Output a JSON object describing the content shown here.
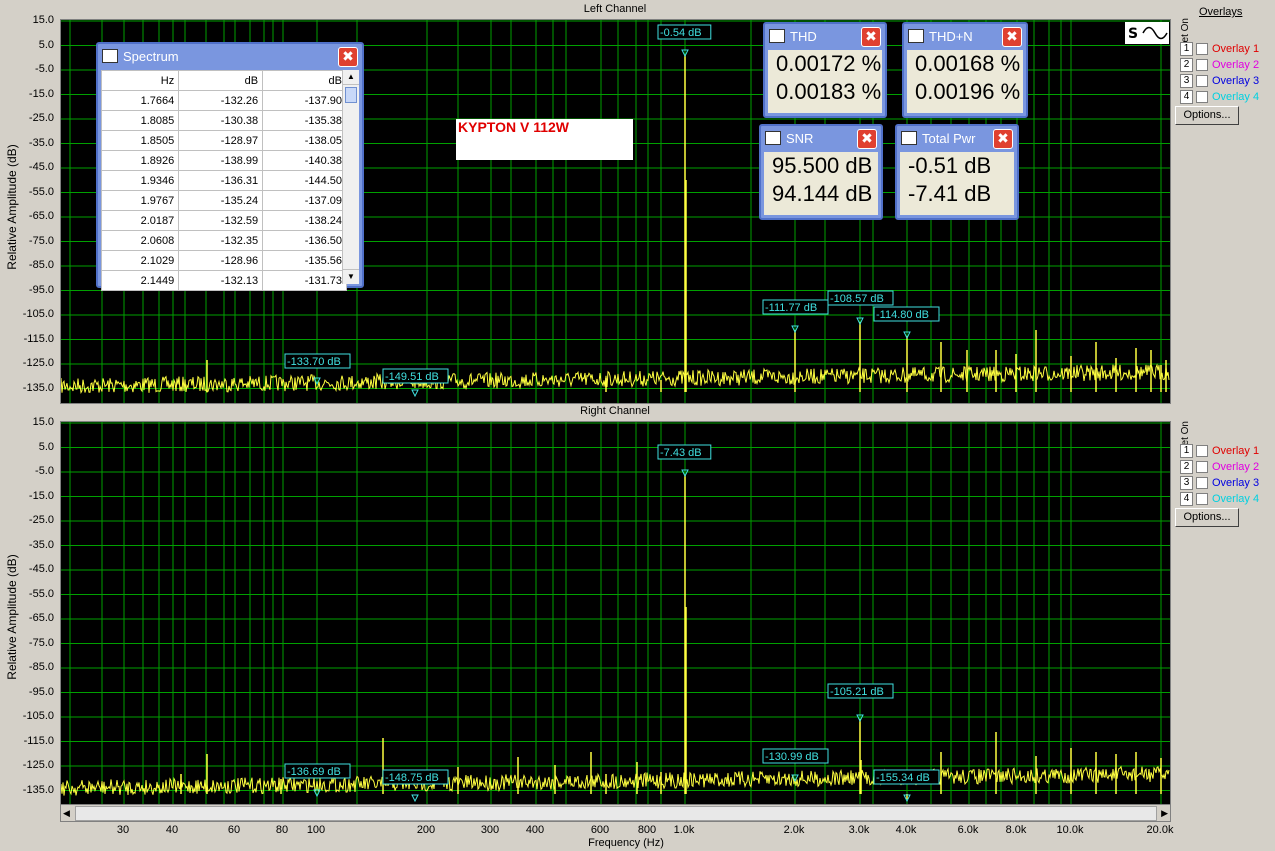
{
  "left": {
    "title": "Left Channel",
    "ylabel": "Relative Amplitude (dB)",
    "markers": [
      "-0.54 dB",
      "-111.77 dB",
      "-108.57 dB",
      "-114.80 dB",
      "-133.70 dB",
      "-149.51 dB"
    ]
  },
  "right": {
    "title": "Right Channel",
    "ylabel": "Relative Amplitude (dB)",
    "markers": [
      "-7.43 dB",
      "-105.21 dB",
      "-130.99 dB",
      "-155.34 dB",
      "-136.69 dB",
      "-148.75 dB"
    ]
  },
  "yticks": [
    "15.0",
    "5.0",
    "-5.0",
    "-15.0",
    "-25.0",
    "-35.0",
    "-45.0",
    "-55.0",
    "-65.0",
    "-75.0",
    "-85.0",
    "-95.0",
    "-105.0",
    "-115.0",
    "-125.0",
    "-135.0"
  ],
  "xticks": [
    "30",
    "40",
    "60",
    "80",
    "100",
    "200",
    "300",
    "400",
    "600",
    "800",
    "1.0k",
    "2.0k",
    "3.0k",
    "4.0k",
    "6.0k",
    "8.0k",
    "10.0k",
    "20.0k"
  ],
  "xlabel": "Frequency (Hz)",
  "overlays": {
    "heading": "Overlays",
    "set_label": "Set",
    "on_label": "On",
    "items": [
      {
        "num": "1",
        "label": "Overlay 1",
        "color": "#e00000"
      },
      {
        "num": "2",
        "label": "Overlay 2",
        "color": "#e000e0"
      },
      {
        "num": "3",
        "label": "Overlay 3",
        "color": "#0000e0"
      },
      {
        "num": "4",
        "label": "Overlay 4",
        "color": "#00d0e0"
      }
    ],
    "options_label": "Options..."
  },
  "spectrum": {
    "title": "Spectrum",
    "headers": [
      "Hz",
      "dB",
      "dB"
    ],
    "rows": [
      [
        "1.7664",
        "-132.26",
        "-137.90"
      ],
      [
        "1.8085",
        "-130.38",
        "-135.38"
      ],
      [
        "1.8505",
        "-128.97",
        "-138.05"
      ],
      [
        "1.8926",
        "-138.99",
        "-140.38"
      ],
      [
        "1.9346",
        "-136.31",
        "-144.50"
      ],
      [
        "1.9767",
        "-135.24",
        "-137.09"
      ],
      [
        "2.0187",
        "-132.59",
        "-138.24"
      ],
      [
        "2.0608",
        "-132.35",
        "-136.50"
      ],
      [
        "2.1029",
        "-128.96",
        "-135.56"
      ],
      [
        "2.1449",
        "-132.13",
        "-131.73"
      ]
    ]
  },
  "meters": {
    "thd": {
      "title": "THD",
      "v1": "0.00172 %",
      "v2": "0.00183 %"
    },
    "thdn": {
      "title": "THD+N",
      "v1": "0.00168 %",
      "v2": "0.00196 %"
    },
    "snr": {
      "title": "SNR",
      "v1": "95.500 dB",
      "v2": "94.144 dB"
    },
    "pwr": {
      "title": "Total Pwr",
      "v1": "-0.51 dB",
      "v2": "-7.41 dB"
    }
  },
  "note": "KYPTON V 112W",
  "colors": {
    "grid": "#00a000",
    "trace": "#ffff40",
    "marker": "#40e0e0",
    "note": "#e00000"
  }
}
